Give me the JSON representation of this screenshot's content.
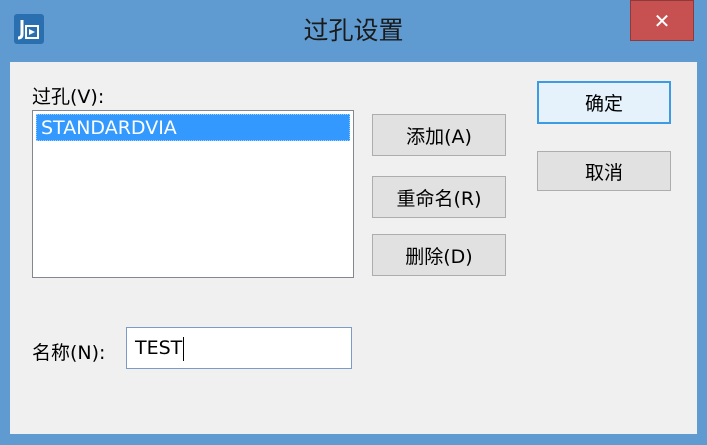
{
  "window": {
    "title": "过孔设置",
    "close_glyph": "✕"
  },
  "via_list": {
    "label": "过孔(V):",
    "items": [
      "STANDARDVIA"
    ],
    "selected_index": 0
  },
  "buttons": {
    "add": "添加(A)",
    "rename": "重命名(R)",
    "delete": "删除(D)",
    "ok": "确定",
    "cancel": "取消"
  },
  "name_field": {
    "label": "名称(N):",
    "value": "TEST"
  },
  "colors": {
    "titlebar": "#5f9bd1",
    "close": "#c75050",
    "selection": "#3399ff"
  }
}
